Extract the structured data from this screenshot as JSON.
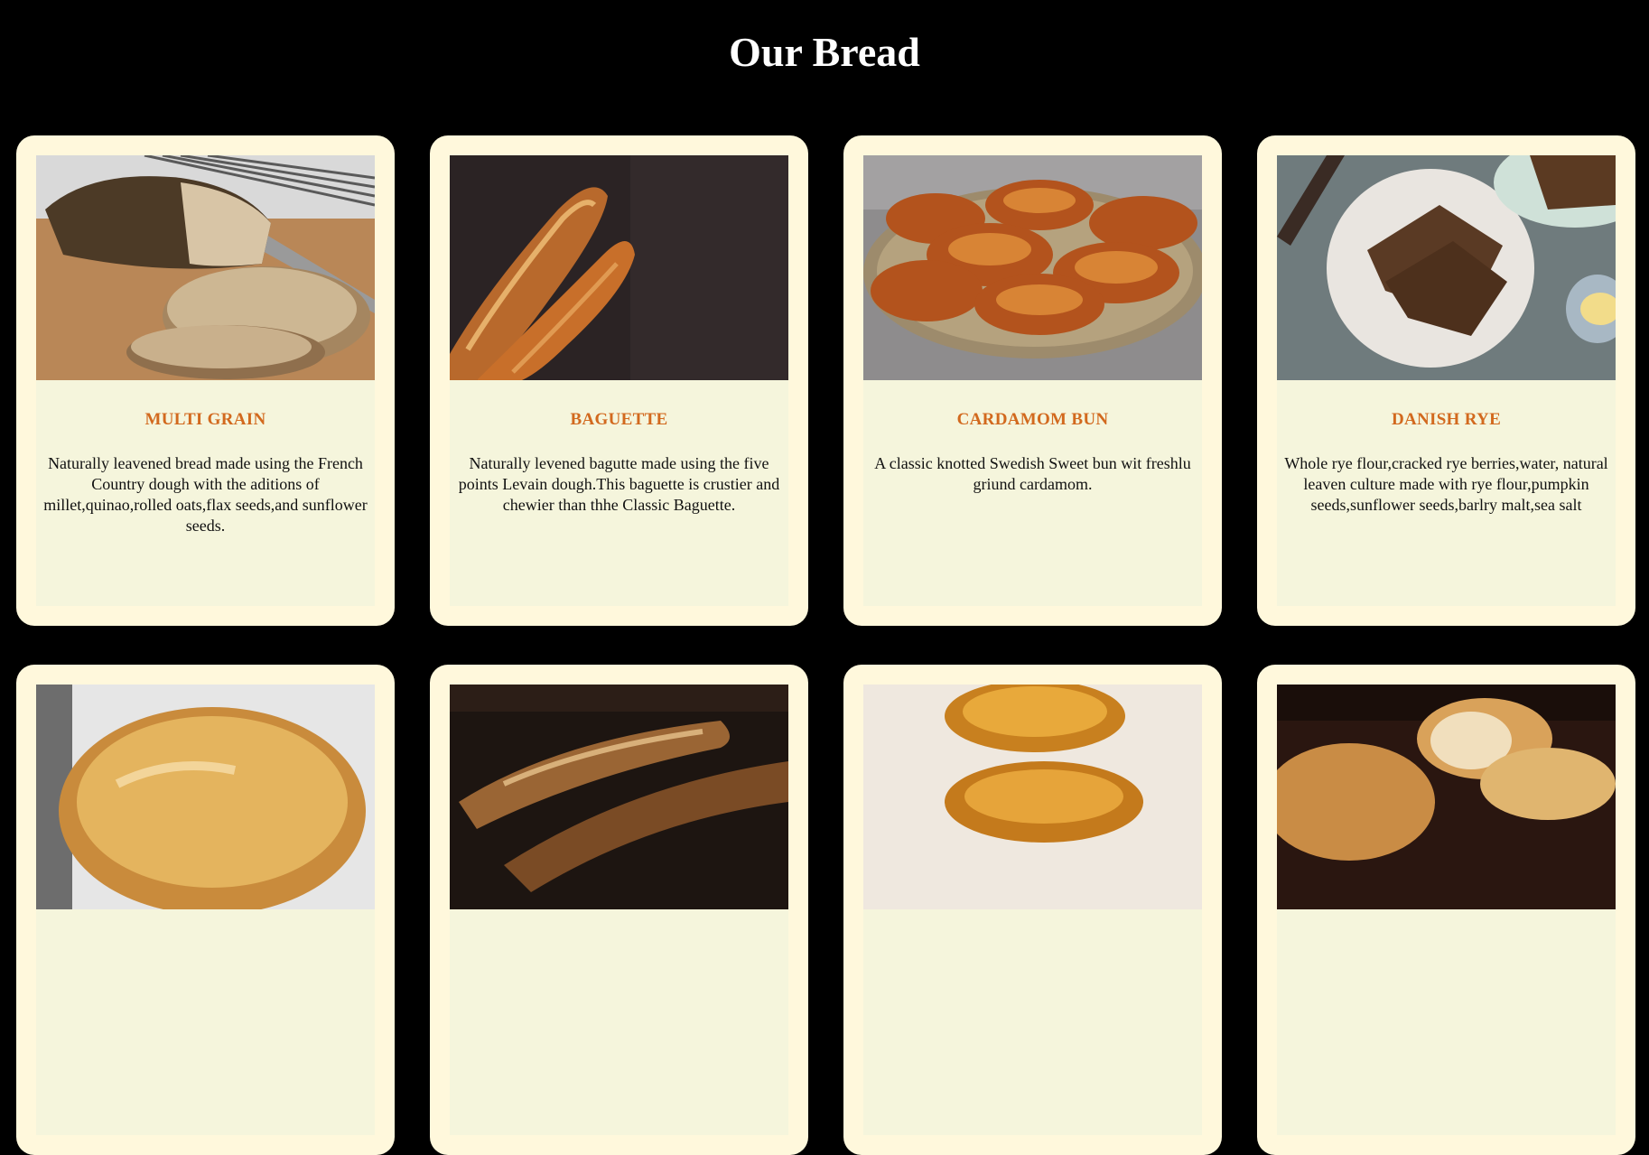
{
  "page": {
    "title": "Our Bread"
  },
  "colors": {
    "background": "#000000",
    "card_outer": "#fff8dc",
    "card_inner": "#f5f5dc",
    "name_text": "#d2691e",
    "title_text": "#ffffff"
  },
  "cards": [
    {
      "name": "MULTI GRAIN",
      "description": "Naturally leavened bread made using the French Country dough with the aditions of millet,quinao,rolled oats,flax seeds,and sunflower seeds.",
      "image": "multigrain-loaf-photo"
    },
    {
      "name": "BAGUETTE",
      "description": "Naturally levened bagutte made using the five points Levain dough.This baguette is crustier and chewier than thhe Classic Baguette.",
      "image": "baguettes-on-dark-photo"
    },
    {
      "name": "CARDAMOM BUN",
      "description": "A classic knotted Swedish Sweet bun wit freshlu griund cardamom.",
      "image": "cardamom-buns-on-plate-photo"
    },
    {
      "name": "DANISH RYE",
      "description": "Whole rye flour,cracked rye berries,water, natural leaven culture made with rye flour,pumpkin seeds,sunflower seeds,barlry malt,sea salt",
      "image": "rye-slices-on-plate-photo"
    },
    {
      "name": "",
      "description": "",
      "image": "country-loaf-photo"
    },
    {
      "name": "",
      "description": "",
      "image": "rustic-baguettes-photo"
    },
    {
      "name": "",
      "description": "",
      "image": "croissants-photo"
    },
    {
      "name": "",
      "description": "",
      "image": "sourdough-loaves-photo"
    }
  ]
}
